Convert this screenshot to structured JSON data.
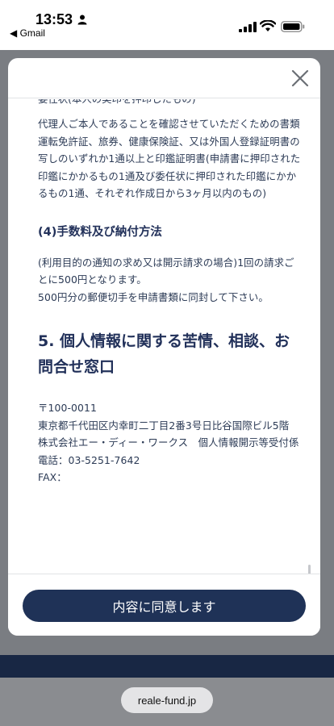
{
  "status_bar": {
    "time": "13:53",
    "back_app": "◀ Gmail"
  },
  "modal": {
    "cut_off_line": "委任状(本人の実印を押印したもの)",
    "paragraph_proxy": "代理人ご本人であることを確認させていただくための書類運転免許証、旅券、健康保険証、又は外国人登録証明書の写しのいずれか1通以上と印鑑証明書(申請書に押印された印鑑にかかるもの1通及び委任状に押印された印鑑にかかるもの1通、それぞれ作成日から3ヶ月以内のもの)",
    "section4_heading": "(4)手数料及び納付方法",
    "fee_line1": "(利用目的の通知の求め又は開示請求の場合)1回の請求ごとに500円となります。",
    "fee_line2": "500円分の郵便切手を申請書類に同封して下さい。",
    "section5_heading": "5. 個人情報に関する苦情、相談、お問合せ窓口",
    "contact": {
      "postal": "〒100-0011",
      "address": "東京都千代田区内幸町二丁目2番3号日比谷国際ビル5階",
      "company": "株式会社エー・ディー・ワークス　個人情報開示等受付係",
      "phone": "電話：03-5251-7642",
      "fax": "FAX："
    },
    "agree_button_label": "内容に同意します",
    "close_icon": "close-icon"
  },
  "browser": {
    "url": "reale-fund.jp"
  },
  "colors": {
    "accent": "#1f3257",
    "text": "#2b3a55",
    "overlay": "#7a7d82",
    "footer_strip": "#182744"
  }
}
